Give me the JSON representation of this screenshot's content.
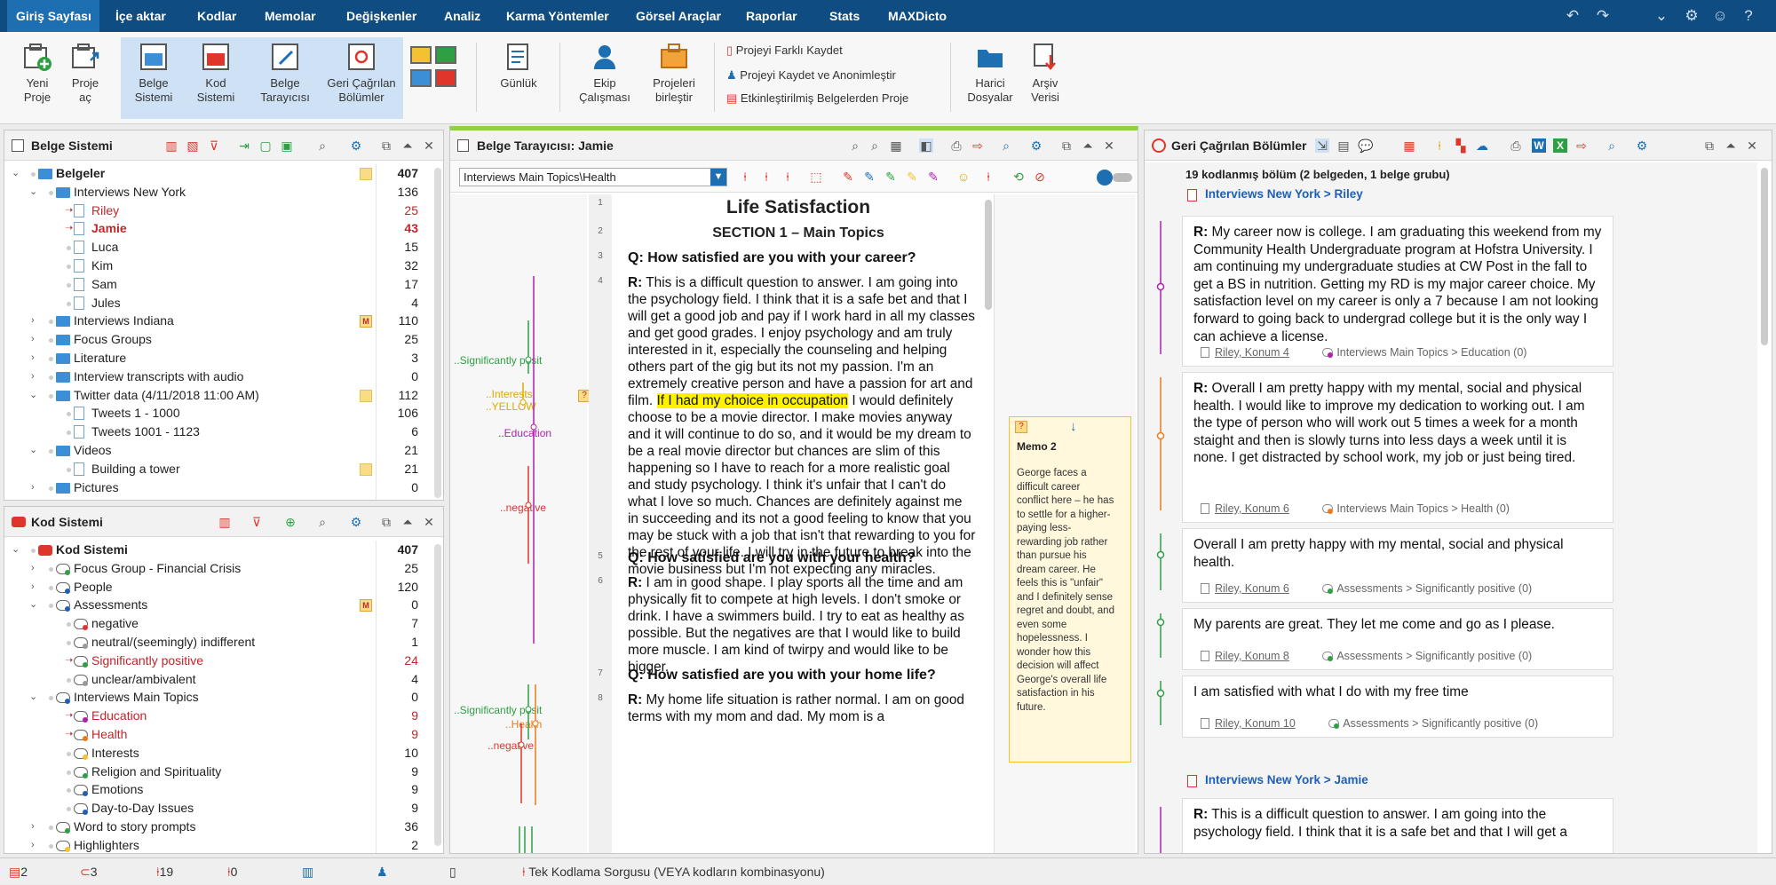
{
  "menubar": {
    "tabs": [
      "Giriş Sayfası",
      "İçe aktar",
      "Kodlar",
      "Memolar",
      "Değişkenler",
      "Analiz",
      "Karma Yöntemler",
      "Görsel Araçlar",
      "Raporlar",
      "Stats",
      "MAXDicto"
    ]
  },
  "ribbon": {
    "new_project": "Yeni\nProje",
    "open_project": "Proje\naç",
    "doc_system": "Belge\nSistemi",
    "code_system": "Kod\nSistemi",
    "doc_browser": "Belge\nTarayıcısı",
    "retrieved": "Geri Çağrılan\nBölümler",
    "logbook": "Günlük",
    "teamwork": "Ekip\nÇalışması",
    "merge_projects": "Projeleri\nbirleştir",
    "save_as": "Projeyi Farklı Kaydet",
    "save_anon": "Projeyi Kaydet ve Anonimleştir",
    "from_activated": "Etkinleştirilmiş Belgelerden Proje",
    "external_files": "Harici\nDosyalar",
    "archive": "Arşiv\nVerisi"
  },
  "doc_system": {
    "title": "Belge Sistemi",
    "rows": [
      {
        "label": "Belgeler",
        "count": "407",
        "level": 0,
        "type": "root",
        "open": true,
        "bold": true,
        "memo": true
      },
      {
        "label": "Interviews New York",
        "count": "136",
        "level": 1,
        "type": "folder",
        "open": true
      },
      {
        "label": "Riley",
        "count": "25",
        "level": 2,
        "type": "doc",
        "red": true
      },
      {
        "label": "Jamie",
        "count": "43",
        "level": 2,
        "type": "doc",
        "red": true,
        "bold": true
      },
      {
        "label": "Luca",
        "count": "15",
        "level": 2,
        "type": "doc"
      },
      {
        "label": "Kim",
        "count": "32",
        "level": 2,
        "type": "doc"
      },
      {
        "label": "Sam",
        "count": "17",
        "level": 2,
        "type": "doc"
      },
      {
        "label": "Jules",
        "count": "4",
        "level": 2,
        "type": "doc"
      },
      {
        "label": "Interviews Indiana",
        "count": "110",
        "level": 1,
        "type": "folder",
        "closed": true,
        "mbadge": true
      },
      {
        "label": "Focus Groups",
        "count": "25",
        "level": 1,
        "type": "folder",
        "closed": true
      },
      {
        "label": "Literature",
        "count": "3",
        "level": 1,
        "type": "folder",
        "closed": true
      },
      {
        "label": "Interview transcripts with audio",
        "count": "0",
        "level": 1,
        "type": "folder",
        "closed": true
      },
      {
        "label": "Twitter data (4/11/2018 11:00 AM)",
        "count": "112",
        "level": 1,
        "type": "folder",
        "open": true,
        "memo": true
      },
      {
        "label": "Tweets 1 - 1000",
        "count": "106",
        "level": 2,
        "type": "doc"
      },
      {
        "label": "Tweets 1001 - 1123",
        "count": "6",
        "level": 2,
        "type": "doc"
      },
      {
        "label": "Videos",
        "count": "21",
        "level": 1,
        "type": "folder",
        "open": true
      },
      {
        "label": "Building a tower",
        "count": "21",
        "level": 2,
        "type": "doc",
        "memo": true
      },
      {
        "label": "Pictures",
        "count": "0",
        "level": 1,
        "type": "folder",
        "closed": true
      }
    ]
  },
  "code_system": {
    "title": "Kod Sistemi",
    "rows": [
      {
        "label": "Kod Sistemi",
        "count": "407",
        "level": 0,
        "open": true,
        "bold": true,
        "root": true
      },
      {
        "label": "Focus Group - Financial Crisis",
        "count": "25",
        "level": 1,
        "closed": true,
        "dot": "#2ea043"
      },
      {
        "label": "People",
        "count": "120",
        "level": 1,
        "closed": true,
        "dot": "#1f5fb5"
      },
      {
        "label": "Assessments",
        "count": "0",
        "level": 1,
        "open": true,
        "dot": "#1f5fb5",
        "mbadge": true
      },
      {
        "label": "negative",
        "count": "7",
        "level": 2,
        "dot": "#e0352b"
      },
      {
        "label": "neutral/(seemingly) indifferent",
        "count": "1",
        "level": 2,
        "dot": "#999"
      },
      {
        "label": "Significantly positive",
        "count": "24",
        "level": 2,
        "dot": "#2ea043",
        "red": true
      },
      {
        "label": "unclear/ambivalent",
        "count": "4",
        "level": 2,
        "dot": "#999"
      },
      {
        "label": "Interviews Main Topics",
        "count": "0",
        "level": 1,
        "open": true,
        "dot": "#1f5fb5"
      },
      {
        "label": "Education",
        "count": "9",
        "level": 2,
        "dot": "#b01fb0",
        "red": true
      },
      {
        "label": "Health",
        "count": "9",
        "level": 2,
        "dot": "#f07a1a",
        "red": true
      },
      {
        "label": "Interests",
        "count": "10",
        "level": 2,
        "dot": "#f2c230"
      },
      {
        "label": "Religion and Spirituality",
        "count": "9",
        "level": 2,
        "dot": "#2ea043"
      },
      {
        "label": "Emotions",
        "count": "9",
        "level": 2,
        "dot": "#1f5fb5"
      },
      {
        "label": "Day-to-Day Issues",
        "count": "9",
        "level": 2,
        "dot": "#1f5fb5"
      },
      {
        "label": "Word to story prompts",
        "count": "36",
        "level": 1,
        "closed": true,
        "dot": "#2ea043"
      },
      {
        "label": "Highlighters",
        "count": "2",
        "level": 1,
        "closed": true,
        "dot": "#f2c230"
      }
    ]
  },
  "doc_browser": {
    "title": "Belge Tarayıcısı: Jamie",
    "code_select": "Interviews Main Topics\\Health",
    "heading1": "Life Satisfaction",
    "heading2": "SECTION 1 – Main Topics",
    "q1": "Q: How satisfied are you with your career?",
    "p4_pre": "This is a difficult question to answer. I am going into the psychology field. I think that it is a safe bet and that I will get a good job and pay if I work hard in all my classes and get good grades. I enjoy psychology and am truly interested in it, especially the counseling and helping others part of the gig but its not my passion. I'm an extremely creative person and have a passion for art and film. ",
    "p4_hl": "If I had my choice in occupation",
    "p4_post": " I would definitely choose to be a movie director. I make movies anyway and it will continue to do so, and it would be my dream to be a real movie director but chances are slim of this happening so I have to reach for a more realistic goal and study psychology. I think it's unfair that I can't do what I love so much. Chances are definitely against me in succeeding and its not a good feeling to know that you may be stuck with a job that isn't that rewarding to you for the rest of your life. I will try in the future to break into the movie business but I'm not expecting any miracles.",
    "q5": "Q: How satisfied are you with your health?",
    "p6": "I am in good shape. I play sports all the time and am physically fit to compete at high levels. I don't smoke or drink. I have a swimmers build. I try to eat as healthy as possible. But the negatives are that I would like to build more muscle. I am kind of twirpy and would like to be bigger.",
    "q7": "Q: How satisfied are you with your home life?",
    "p8": "My home life situation is rather normal. I am on good terms with my mom and dad. My mom is a",
    "r_label": "R:",
    "line_numbers": [
      "1",
      "2",
      "3",
      "4",
      "5",
      "6",
      "7",
      "8"
    ],
    "code_labels": {
      "sig_pos": "..Significantly posit",
      "interests": "..Interests",
      "yellow": "..YELLOW",
      "education": "..Education",
      "negative": "..negative",
      "sig_pos2": "..Significantly posit",
      "health": "..Health",
      "negative2": "..negative"
    },
    "memo": {
      "title": "Memo 2",
      "text": "George faces a difficult career conflict here – he has to settle for a higher-paying less-rewarding job rather than pursue his dream career. He feels this is \"unfair\" and I definitely sense regret and doubt, and even some hopelessness. I wonder how this decision will affect George's overall life satisfaction in his future."
    }
  },
  "retrieved": {
    "title": "Geri Çağrılan Bölümler",
    "summary": "19 kodlanmış bölüm (2 belgeden, 1 belge grubu)",
    "group1": "Interviews New York > Riley",
    "group2": "Interviews New York > Jamie",
    "segments": [
      {
        "text": "My career now is college. I am graduating this weekend from my Community Health Undergraduate program at Hofstra University. I am continuing my undergraduate studies at CW Post in the fall to get a BS in nutrition. Getting my RD is my major career choice. My satisfaction level on my career is only a 7 because I am not looking forward to going back to undergrad college but it is the only way I can achieve a license.",
        "r": true,
        "src": "Riley, Konum 4",
        "code": "Interviews Main Topics > Education (0)",
        "color": "#b01fb0"
      },
      {
        "text": "Overall I am pretty happy with my mental, social and physical health. I would like to improve my dedication to working out. I am the type of person who will work out 5 times a week for a month staight and then is slowly turns into less days a week until it is none. I get distracted by school work, my job or just being tired.",
        "r": true,
        "src": "Riley, Konum 6",
        "code": "Interviews Main Topics > Health (0)",
        "color": "#f07a1a"
      },
      {
        "text": "Overall I am pretty happy with my mental, social and physical health.",
        "r": false,
        "src": "Riley, Konum 6",
        "code": "Assessments > Significantly positive (0)",
        "color": "#2ea043"
      },
      {
        "text": "My parents are great. They let me come and go as I please.",
        "r": false,
        "src": "Riley, Konum 8",
        "code": "Assessments > Significantly positive (0)",
        "color": "#2ea043"
      },
      {
        "text": "I am satisfied with what I do with my free time",
        "r": false,
        "src": "Riley, Konum 10",
        "code": "Assessments > Significantly positive (0)",
        "color": "#2ea043"
      }
    ],
    "last_text": "This is a difficult question to answer. I am going into the psychology field. I think that it is a safe bet and that I will get a"
  },
  "statusbar": {
    "docs": "2",
    "codes": "3",
    "coded": "19",
    "memos": "0",
    "query": "Tek Kodlama Sorgusu (VEYA kodların kombinasyonu)"
  }
}
